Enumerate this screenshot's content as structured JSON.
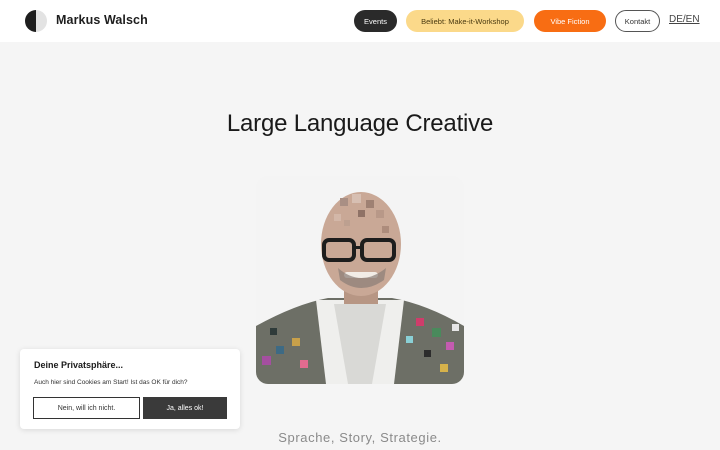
{
  "header": {
    "brand": "Markus Walsch",
    "nav": {
      "events": "Events",
      "workshop": "Beliebt: Make-it-Workshop",
      "vibe": "Vibe Fiction",
      "kontakt": "Kontakt"
    },
    "language": "DE/EN"
  },
  "hero": {
    "title": "Large Language Creative",
    "tagline": "Sprache, Story, Strategie."
  },
  "cookie": {
    "title": "Deine Privatsphäre...",
    "text": "Auch hier sind Cookies am Start! Ist das OK für dich?",
    "decline": "Nein, will ich nicht.",
    "accept": "Ja, alles ok!"
  },
  "colors": {
    "accent_orange": "#f86d13",
    "accent_yellow": "#fbd98a",
    "dark": "#2a2a2a"
  }
}
